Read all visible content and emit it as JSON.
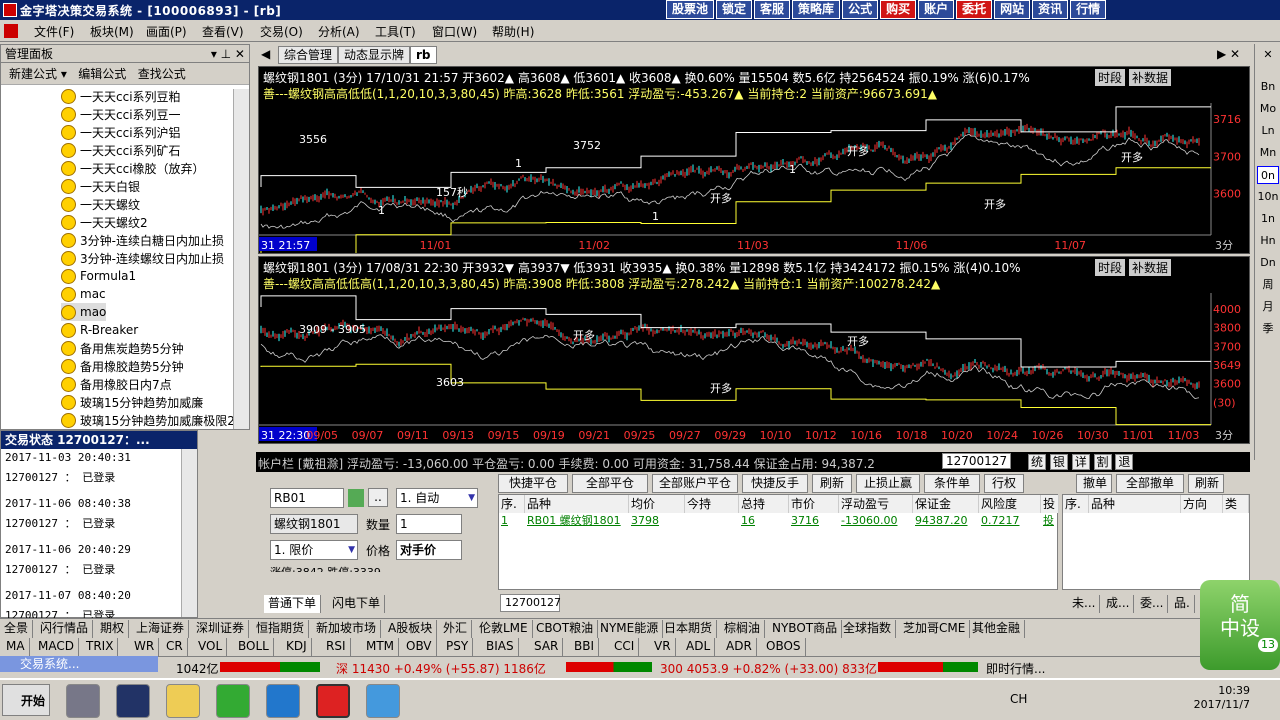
{
  "window": {
    "title": "金字塔决策交易系统 - [100006893] - [rb]"
  },
  "toolbar": [
    "股票池",
    "锁定",
    "客服",
    "策略库",
    "公式",
    "购买",
    "账户",
    "委托",
    "网站",
    "资讯",
    "行情"
  ],
  "menu": [
    "文件(F)",
    "板块(M)",
    "画面(P)",
    "查看(V)",
    "交易(O)",
    "分析(A)",
    "工具(T)",
    "窗口(W)",
    "帮助(H)"
  ],
  "panel": {
    "title": "管理面板",
    "tools": [
      "新建公式 ▾",
      "编辑公式",
      "查找公式"
    ],
    "items": [
      "一天天cci系列豆粕",
      "一天天cci系列豆一",
      "一天天cci系列沪铝",
      "一天天cci系列矿石",
      "一天天cci橡胶（放弃）",
      "一天天白银",
      "一天天螺纹",
      "一天天螺纹2",
      "3分钟-连续白糖日内加止损",
      "3分钟-连续螺纹日内加止损",
      "Formula1",
      "mac",
      "mao",
      "R-Breaker",
      "备用焦炭趋势5分钟",
      "备用橡胶趋势5分钟",
      "备用橡胶日内7点",
      "玻璃15分钟趋势加威廉",
      "玻璃15分钟趋势加威廉极限2"
    ]
  },
  "status": {
    "title": "交易状态 12700127：...",
    "lines": [
      "2017-11-03 20:40:31",
      "12700127 ： 已登录",
      "2017-11-06 08:40:38",
      "12700127 ： 已登录",
      "2017-11-06 20:40:29",
      "12700127 ： 已登录",
      "2017-11-07 08:40:20",
      "12700127 ： 已登录"
    ]
  },
  "tabs": [
    "综合管理",
    "动态显示牌",
    "rb"
  ],
  "chart1": {
    "header": "螺纹钢1801 (3分) 17/10/31 21:57 开3602▲ 高3608▲ 低3601▲ 收3608▲ 换0.60% 量15504 数5.6亿 持2564524 振0.19% 涨(6)0.17%",
    "formula": "善---螺纹钢高高低低(1,1,20,10,3,3,80,45) 昨高:3628 昨低:3561 浮动盈亏:-453.267▲ 当前持仓:2 当前资产:96673.691▲",
    "buttons": [
      "时段",
      "补数据"
    ],
    "price_labels": [
      "3716",
      "3700",
      "3600"
    ],
    "annot": [
      "3556",
      "157秒",
      "3752",
      "开多",
      "开多",
      "开多",
      "开多",
      "1",
      "1",
      "1",
      "1"
    ],
    "x_labels": [
      "31 21:57",
      "11/01",
      "11/02",
      "11/03",
      "11/06",
      "11/07",
      "3分"
    ]
  },
  "chart2": {
    "header": "螺纹钢1801 (3分) 17/08/31 22:30 开3932▼ 高3937▼ 低3931 收3935▲ 换0.38% 量12898 数5.1亿 持3424172 振0.15% 涨(4)0.10%",
    "formula": "善---螺纹高高低低高(1,1,20,10,3,3,80,45) 昨高:3908 昨低:3808 浮动盈亏:278.242▲ 当前持仓:1 当前资产:100278.242▲",
    "buttons": [
      "时段",
      "补数据"
    ],
    "price_labels": [
      "4000",
      "3800",
      "3700",
      "3649",
      "3600",
      "(30)"
    ],
    "annot": [
      "3909 - 3905",
      "3603",
      "开多",
      "开多",
      "开多"
    ],
    "x_labels": [
      "31 22:30",
      "09/05",
      "09/07",
      "09/11",
      "09/13",
      "09/15",
      "09/19",
      "09/21",
      "09/25",
      "09/27",
      "09/29",
      "10/10",
      "10/12",
      "10/16",
      "10/18",
      "10/20",
      "10/24",
      "10/26",
      "10/30",
      "11/01",
      "11/03",
      "3分"
    ]
  },
  "right_toolbar": [
    "Bn",
    "Mo",
    "Ln",
    "Mn",
    "0n",
    "10n",
    "1n",
    "Hn",
    "Dn",
    "周",
    "月",
    "季"
  ],
  "account": {
    "bar": "帐户栏 [戴祖滁]  浮动盈亏: -13,060.00   平仓盈亏: 0.00   手续费: 0.00   可用资金: 31,758.44   保证金占用: 94,387.2",
    "account_id": "12700127",
    "mini_buttons": [
      "统",
      "银",
      "详",
      "割",
      "退"
    ],
    "buttons": [
      "快捷平仓",
      "全部平仓",
      "全部账户平仓",
      "快捷反手",
      "刷新",
      "止损止赢",
      "条件单",
      "行权"
    ],
    "right_buttons": [
      "撤单",
      "全部撤单",
      "刷新"
    ],
    "columns": [
      "序.",
      "品种",
      "均价",
      "今持",
      "总持",
      "市价",
      "浮动盈亏",
      "保证金",
      "风险度",
      "投"
    ],
    "rows": [
      [
        "1",
        "RB01 螺纹钢1801",
        "3798",
        "",
        "16",
        "3716",
        "-13060.00",
        "94387.20",
        "0.7217",
        "投"
      ]
    ],
    "right_columns": [
      "序.",
      "品种",
      "方向",
      "类"
    ]
  },
  "order": {
    "code": "RB01",
    "name": "螺纹钢1801",
    "mode": "1. 自动",
    "qty_label": "数量",
    "qty": "1",
    "price_type": "1. 限价",
    "price_label": "价格",
    "price": "对手价",
    "limit": "涨停:3842 跌停:3339",
    "tabs": [
      "普通下单",
      "闪电下单"
    ],
    "account_tab": "12700127",
    "right_tabs": [
      "未...",
      "成...",
      "委...",
      "品."
    ]
  },
  "bottom_tabs": [
    "全景",
    "闪行情品",
    "期权",
    "上海证券",
    "深圳证券",
    "恒指期货",
    "新加坡市场",
    "A股板块",
    "外汇",
    "伦敦LME",
    "CBOT粮油",
    "NYME能源",
    "日本期货",
    "棕榈油",
    "NYBOT商品",
    "全球指数",
    "芝加哥CME",
    "其他金融"
  ],
  "indicator_tabs": [
    "MA",
    "MACD",
    "TRIX",
    "WR",
    "CR",
    "VOL",
    "BOLL",
    "KDJ",
    "RSI",
    "MTM",
    "OBV",
    "PSY",
    "BIAS",
    "SAR",
    "BBI",
    "CCI",
    "VR",
    "ADL",
    "ADR",
    "OBOS"
  ],
  "quotes": [
    {
      "text": "1042亿"
    },
    {
      "text": "深 11430 +0.49% (+55.87) 1186亿"
    },
    {
      "text": "300 4053.9 +0.82% (+33.00) 833亿"
    },
    {
      "text": "即时行情..."
    }
  ],
  "mini_window": "交易系统...",
  "taskbar": {
    "start": "开始",
    "time": "10:39",
    "date": "2017/11/7",
    "ime": "CH"
  },
  "widget": {
    "line1": "简",
    "line2": "中设",
    "badge": "13"
  }
}
